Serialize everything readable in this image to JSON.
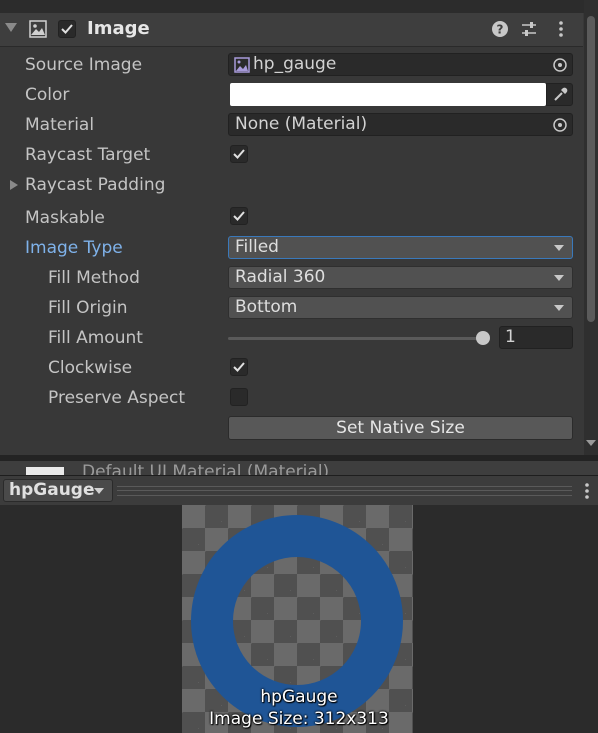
{
  "component": {
    "title": "Image",
    "enabled": true,
    "help_icon": "help-icon",
    "presets_icon": "presets-icon",
    "menu_icon": "more-vert-icon"
  },
  "props": {
    "source_image": {
      "label": "Source Image",
      "value": "hp_gauge"
    },
    "color": {
      "label": "Color",
      "value": "#ffffff"
    },
    "material": {
      "label": "Material",
      "value": "None (Material)"
    },
    "raycast_target": {
      "label": "Raycast Target",
      "checked": true
    },
    "raycast_padding": {
      "label": "Raycast Padding"
    },
    "maskable": {
      "label": "Maskable",
      "checked": true
    },
    "image_type": {
      "label": "Image Type",
      "value": "Filled"
    },
    "fill_method": {
      "label": "Fill Method",
      "value": "Radial 360"
    },
    "fill_origin": {
      "label": "Fill Origin",
      "value": "Bottom"
    },
    "fill_amount": {
      "label": "Fill Amount",
      "value": "1",
      "level": 1.0
    },
    "clockwise": {
      "label": "Clockwise",
      "checked": true
    },
    "preserve_aspect": {
      "label": "Preserve Aspect",
      "checked": false
    },
    "set_native_size": "Set Native Size"
  },
  "material_row": {
    "text": "Default UI Material (Material)"
  },
  "preview": {
    "selector": "hpGauge",
    "name": "hpGauge",
    "size_text": "Image Size: 312x313",
    "ring_color": "#1f5596"
  },
  "colors": {
    "label_active": "#7fb2ea",
    "panel_bg": "#383838"
  }
}
